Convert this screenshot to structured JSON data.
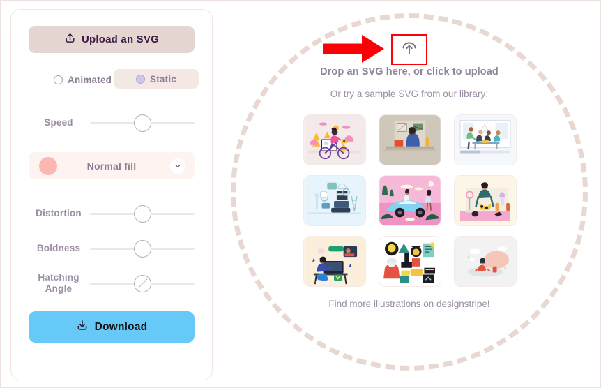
{
  "colors": {
    "upload_button_bg": "#e6d6d2",
    "upload_button_text": "#3c1a46",
    "download_button_bg": "#66c9f7",
    "download_button_text": "#141318",
    "label_muted": "#9b8da4",
    "fill_swatch": "#fcb8b0",
    "fill_select_bg": "#fdf3f1",
    "static_pill_bg": "#f3e8e3",
    "radio_selected": "#cdc5ea",
    "dashed_circle_border": "#e8d8d1",
    "highlight_box_border": "#fb0007",
    "annotation_arrow": "#fb0007",
    "panel_border": "#f2e6e1",
    "track": "#f1e7e2",
    "knob_border": "#b8aabf"
  },
  "left_panel": {
    "upload_button": {
      "label": "Upload an SVG",
      "icon": "upload-icon"
    },
    "mode_options": [
      {
        "label": "Animated",
        "selected": false
      },
      {
        "label": "Static",
        "selected": true
      }
    ],
    "sliders": [
      {
        "name": "speed",
        "label": "Speed",
        "value_pct": 50,
        "handle": "plain"
      },
      {
        "name": "distortion",
        "label": "Distortion",
        "value_pct": 50,
        "handle": "plain"
      },
      {
        "name": "boldness",
        "label": "Boldness",
        "value_pct": 50,
        "handle": "plain"
      },
      {
        "name": "hatching-angle",
        "label": "Hatching\nAngle",
        "label_line1": "Hatching",
        "label_line2": "Angle",
        "value_pct": 50,
        "handle": "diagonal"
      }
    ],
    "fill_select": {
      "value": "Normal fill",
      "swatch_color": "#fcb8b0",
      "chevron": "chevron-down-icon"
    },
    "download_button": {
      "label": "Download",
      "icon": "download-icon"
    }
  },
  "drop_zone": {
    "upload_icon": "upload-cloud-icon",
    "title": "Drop an SVG here, or click to upload",
    "subtitle": "Or try a sample SVG from our library:",
    "footer_prefix": "Find more illustrations on ",
    "footer_link": "designstripe",
    "footer_suffix": "!",
    "samples": [
      {
        "name": "sample-1",
        "alt": "Woman cycling past camper van among pink and yellow trees",
        "bg": "#f4eaea"
      },
      {
        "name": "sample-2",
        "alt": "Person in blue hoodie at desk with orange laptop in beige room",
        "bg": "#cfc7ba"
      },
      {
        "name": "sample-3",
        "alt": "Team meeting around a table in a bright office",
        "bg": "#f4f7fb"
      },
      {
        "name": "sample-4",
        "alt": "Pile of luggage, clothes and travel items on light blue",
        "bg": "#e8f4fb"
      },
      {
        "name": "sample-5",
        "alt": "Two women beside a blue car on a pink desert road",
        "bg": "#f7b9d8"
      },
      {
        "name": "sample-6",
        "alt": "Woman with flowers and bottles on pink counter",
        "bg": "#fdf6e6"
      },
      {
        "name": "sample-7",
        "alt": "Student on video call at desk with laptop",
        "bg": "#fbeedb"
      },
      {
        "name": "sample-8",
        "alt": "Collage of graduates, documents and shapes",
        "bg": "#ffffff"
      },
      {
        "name": "sample-9",
        "alt": "Person meditating on a cloud",
        "bg": "#f2f2f2"
      }
    ]
  },
  "annotations": {
    "arrow": {
      "name": "pointing-arrow",
      "direction": "right",
      "color": "#fb0007"
    },
    "highlight": {
      "name": "upload-target-highlight",
      "color": "#fb0007"
    }
  }
}
